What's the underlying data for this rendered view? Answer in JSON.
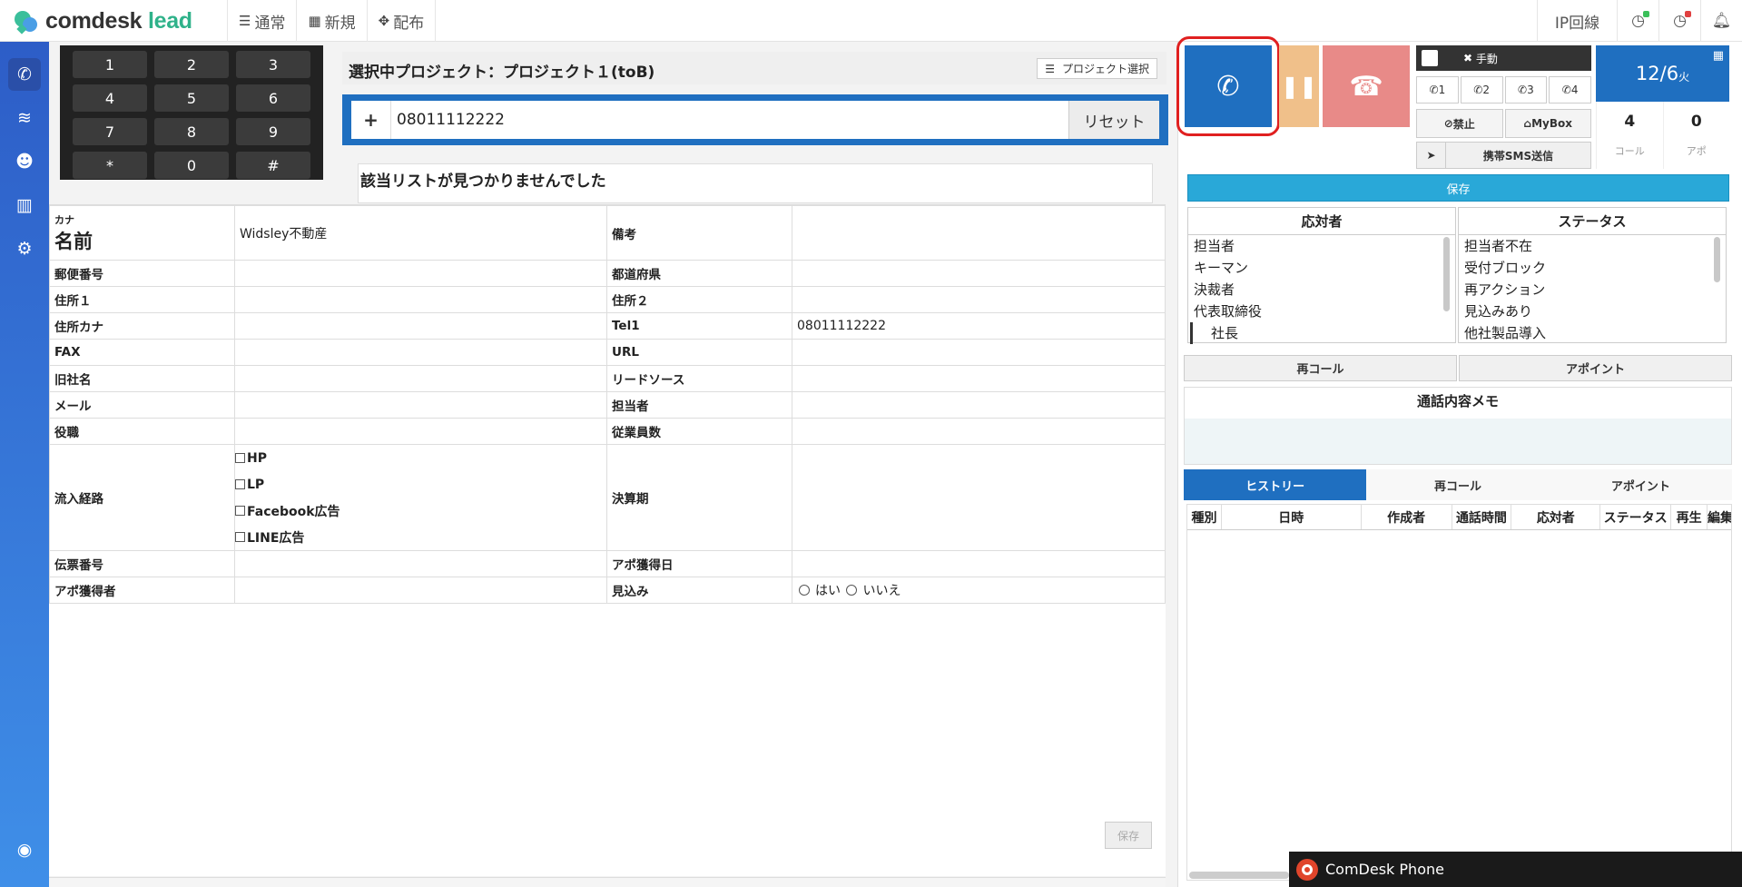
{
  "app": {
    "logo_main": "comdesk",
    "logo_accent": "lead"
  },
  "topnav": [
    {
      "label": "通常",
      "icon": "list-icon"
    },
    {
      "label": "新規",
      "icon": "grid-icon"
    },
    {
      "label": "配布",
      "icon": "expand-icon"
    }
  ],
  "topright": {
    "ip_label": "IP回線"
  },
  "keypad": [
    [
      "1",
      "2",
      "3"
    ],
    [
      "4",
      "5",
      "6"
    ],
    [
      "7",
      "8",
      "9"
    ],
    [
      "*",
      "0",
      "#"
    ]
  ],
  "project": {
    "title": "選択中プロジェクト：プロジェクト１(toB)",
    "select_button": "プロジェクト選択"
  },
  "dial": {
    "plus": "+",
    "number": "08011112222",
    "reset": "リセット"
  },
  "notfound": "該当リストが見つかりませんでした",
  "form": {
    "kana_label": "カナ",
    "name_label": "名前",
    "name_value": "Widsley不動産",
    "remarks_label": "備考",
    "rows": [
      {
        "l1": "郵便番号",
        "v1": "",
        "l2": "都道府県",
        "v2": ""
      },
      {
        "l1": "住所１",
        "v1": "",
        "l2": "住所２",
        "v2": ""
      },
      {
        "l1": "住所カナ",
        "v1": "",
        "l2": "Tel1",
        "v2": "08011112222"
      },
      {
        "l1": "FAX",
        "v1": "",
        "l2": "URL",
        "v2": ""
      },
      {
        "l1": "旧社名",
        "v1": "",
        "l2": "リードソース",
        "v2": ""
      },
      {
        "l1": "メール",
        "v1": "",
        "l2": "担当者",
        "v2": ""
      },
      {
        "l1": "役職",
        "v1": "",
        "l2": "従業員数",
        "v2": ""
      }
    ],
    "inflow_label": "流入経路",
    "inflow_options": [
      "HP",
      "LP",
      "Facebook広告",
      "LINE広告"
    ],
    "settlement_label": "決算期",
    "voucher_label": "伝票番号",
    "apo_date_label": "アポ獲得日",
    "apo_person_label": "アポ獲得者",
    "prospect_label": "見込み",
    "prospect_yes": "はい",
    "prospect_no": "いいえ",
    "save": "保存"
  },
  "callpanel": {
    "manual": "手動",
    "lines": [
      "1",
      "2",
      "3",
      "4"
    ],
    "block": "禁止",
    "mybox": "MyBox",
    "sms": "携帯SMS送信",
    "date": "12/6",
    "weekday": "火",
    "call_count": "4",
    "call_label": "コール",
    "apo_count": "0",
    "apo_label": "アポ",
    "save": "保存"
  },
  "respondent": {
    "header": "応対者",
    "items": [
      "担当者",
      "キーマン",
      "決裁者",
      "代表取締役",
      "社長"
    ]
  },
  "status": {
    "header": "ステータス",
    "items": [
      "担当者不在",
      "受付ブロック",
      "再アクション",
      "見込みあり",
      "他社製品導入"
    ]
  },
  "actions": {
    "recall": "再コール",
    "appoint": "アポイント"
  },
  "memo": {
    "title": "通話内容メモ"
  },
  "tabs": [
    "ヒストリー",
    "再コール",
    "アポイント"
  ],
  "history_headers": [
    "種別",
    "日時",
    "作成者",
    "通話時間",
    "応対者",
    "ステータス",
    "再生",
    "編集"
  ],
  "phone": {
    "label": "ComDesk Phone"
  },
  "colors": {
    "primary": "#1f6fc0",
    "hold": "#f0c08a",
    "hangup": "#e88a88",
    "highlight_ring": "#e02020",
    "save_bar": "#29a8d8"
  }
}
